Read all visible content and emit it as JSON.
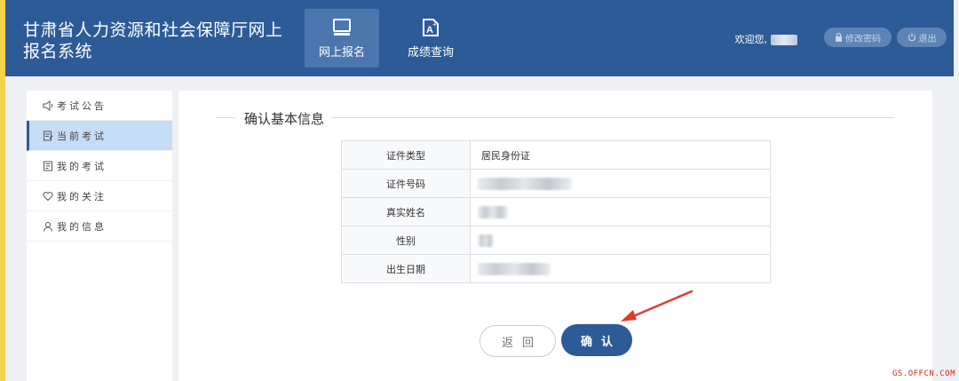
{
  "header": {
    "site_title": "甘肃省人力资源和社会保障厅网上报名系统",
    "nav": [
      {
        "label": "网上报名",
        "icon": "monitor-icon",
        "active": true
      },
      {
        "label": "成绩查询",
        "icon": "grade-document-icon",
        "active": false
      }
    ],
    "welcome_label": "欢迎您,",
    "change_password_label": "修改密码",
    "logout_label": "退出"
  },
  "sidebar": {
    "items": [
      {
        "label": "考试公告",
        "icon": "announcement-icon"
      },
      {
        "label": "当前考试",
        "icon": "edit-document-icon",
        "active": true
      },
      {
        "label": "我的考试",
        "icon": "exam-list-icon"
      },
      {
        "label": "我的关注",
        "icon": "heart-icon"
      },
      {
        "label": "我的信息",
        "icon": "user-icon"
      }
    ]
  },
  "main": {
    "section_title": "确认基本信息",
    "rows": [
      {
        "label": "证件类型",
        "value": "居民身份证"
      },
      {
        "label": "证件号码",
        "value": ""
      },
      {
        "label": "真实姓名",
        "value": ""
      },
      {
        "label": "性别",
        "value": ""
      },
      {
        "label": "出生日期",
        "value": ""
      }
    ],
    "back_label": "返回",
    "confirm_label": "确认"
  },
  "watermark": "GS.OFFCN.COM",
  "colors": {
    "brand": "#2d5b97",
    "sidebar_active": "#c7dcf5",
    "annotation_arrow": "#e03a2e"
  }
}
